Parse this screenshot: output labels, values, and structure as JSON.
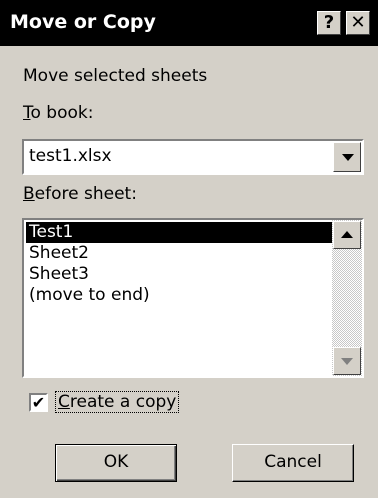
{
  "window": {
    "title": "Move or Copy",
    "help_glyph": "?",
    "close_glyph": "✕"
  },
  "dialog": {
    "heading": "Move selected sheets",
    "to_book": {
      "accel": "T",
      "rest": "o book:"
    },
    "book_value": "test1.xlsx",
    "before_sheet": {
      "accel": "B",
      "rest": "efore sheet:"
    },
    "sheets": [
      "Test1",
      "Sheet2",
      "Sheet3",
      "(move to end)"
    ],
    "selected_sheet": "Test1",
    "create_copy": {
      "checked": true,
      "check_glyph": "✔",
      "accel": "C",
      "rest": "reate a copy"
    },
    "ok_label": "OK",
    "cancel_label": "Cancel"
  }
}
